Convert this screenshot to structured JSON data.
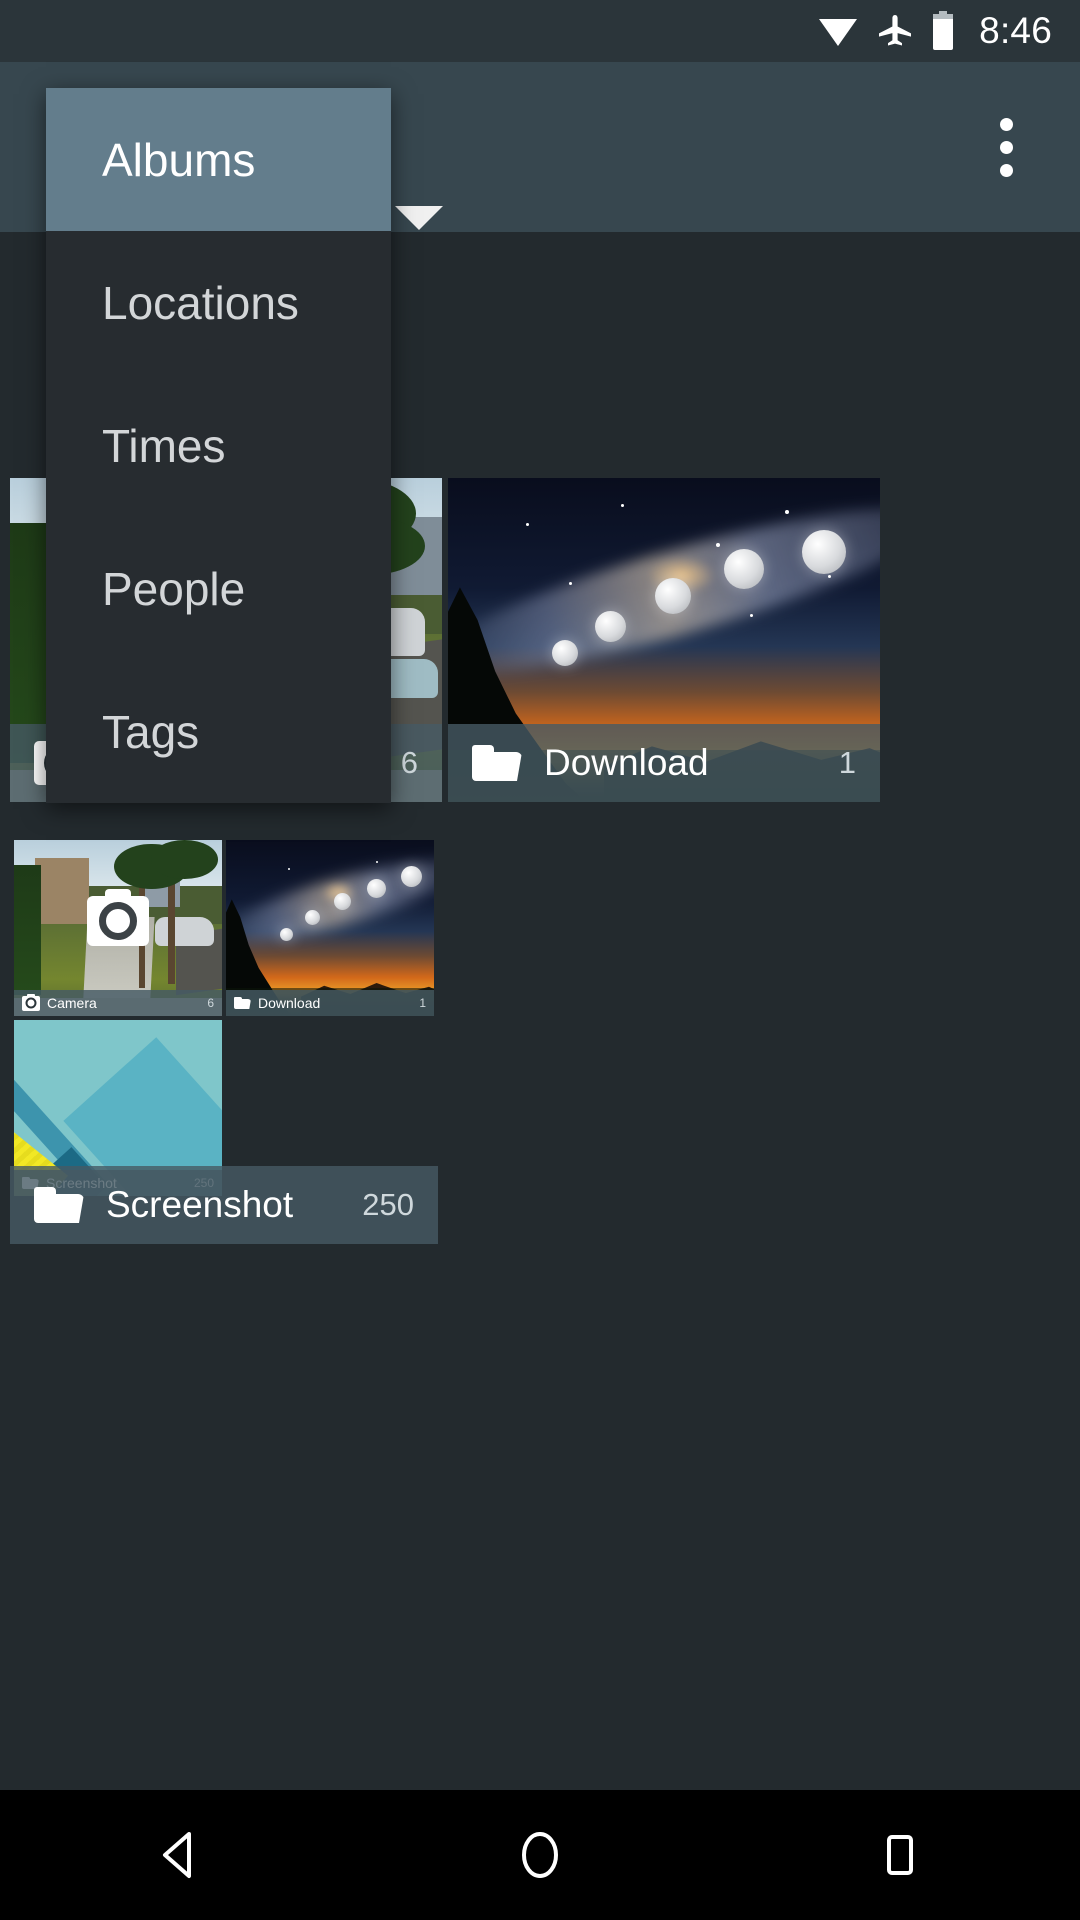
{
  "status_bar": {
    "time": "8:46",
    "icons": [
      "wifi-icon",
      "airplane-mode-icon",
      "battery-icon"
    ]
  },
  "action_bar": {
    "spinner_label": "Albums",
    "caret_icon": "chevron-down-icon",
    "overflow_icon": "overflow-menu-icon",
    "background_color": "#37474f"
  },
  "spinner_dropdown": {
    "open": true,
    "selected": "Albums",
    "selected_color": "#637d8c",
    "background_color": "#272c30",
    "items": [
      {
        "label": "Albums",
        "selected": true
      },
      {
        "label": "Locations",
        "selected": false
      },
      {
        "label": "Times",
        "selected": false
      },
      {
        "label": "People",
        "selected": false
      },
      {
        "label": "Tags",
        "selected": false
      }
    ]
  },
  "albums": [
    {
      "name": "Camera",
      "count": "6",
      "icon": "camera-icon",
      "thumbnail": "sidewalk-palms-photo"
    },
    {
      "name": "Download",
      "count": "1",
      "icon": "folder-icon",
      "thumbnail": "moon-arc-night-sky-photo"
    },
    {
      "name": "Screenshot",
      "count": "250",
      "icon": "folder-icon",
      "thumbnail": "gallery-screenshot-recursive"
    }
  ],
  "nested_screenshot": {
    "albums": [
      {
        "name": "Camera",
        "count": "6",
        "icon": "camera-icon"
      },
      {
        "name": "Download",
        "count": "1",
        "icon": "folder-icon"
      },
      {
        "name": "Screenshot",
        "count": "250",
        "icon": "folder-icon"
      }
    ]
  },
  "nav_bar": {
    "back_label": "back-icon",
    "home_label": "home-icon",
    "recents_label": "recents-icon"
  },
  "theme": {
    "background": "#232a2e",
    "label_overlay": "rgba(70,90,100,0.80)"
  }
}
